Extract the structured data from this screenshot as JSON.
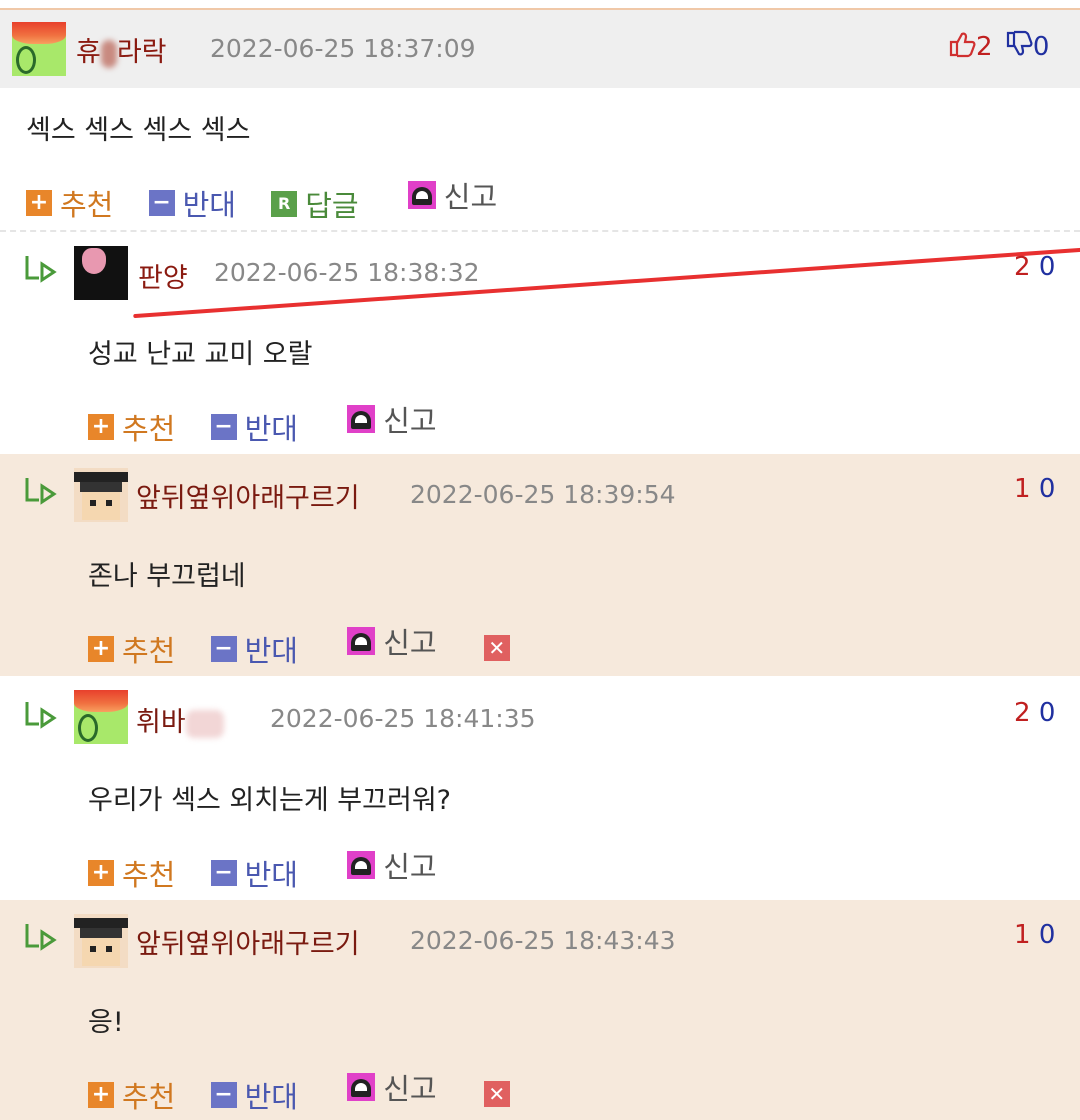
{
  "main": {
    "nickname_left": "휴",
    "nickname_right": "라락",
    "date": "2022-06-25 18:37:09",
    "up_count": "2",
    "down_count": "0",
    "body": "섹스 섹스 섹스 섹스",
    "actions": {
      "recommend": "추천",
      "oppose": "반대",
      "reply": "답글",
      "report": "신고",
      "reply_badge": "R"
    }
  },
  "replies": [
    {
      "nickname": "판양",
      "date": "2022-06-25 18:38:32",
      "up": "2",
      "down": "0",
      "body": "성교 난교 교미 오랄",
      "recommend": "추천",
      "oppose": "반대",
      "report": "신고"
    },
    {
      "nickname": "앞뒤옆위아래구르기",
      "date": "2022-06-25 18:39:54",
      "up": "1",
      "down": "0",
      "body": "존나 부끄럽네",
      "recommend": "추천",
      "oppose": "반대",
      "report": "신고"
    },
    {
      "nickname": "휘바",
      "date": "2022-06-25 18:41:35",
      "up": "2",
      "down": "0",
      "body": "우리가 섹스 외치는게 부끄러워?",
      "recommend": "추천",
      "oppose": "반대",
      "report": "신고"
    },
    {
      "nickname": "앞뒤옆위아래구르기",
      "date": "2022-06-25 18:43:43",
      "up": "1",
      "down": "0",
      "body": "응!",
      "recommend": "추천",
      "oppose": "반대",
      "report": "신고"
    }
  ],
  "icons": {
    "thumb_up": "thumb-up-icon",
    "thumb_down": "thumb-down-icon",
    "reply_arrow": "reply-arrow-icon",
    "report": "siren-icon",
    "delete": "delete-icon"
  },
  "colors": {
    "recommend": "#e8862a",
    "oppose": "#6b74c6",
    "reply": "#5aa04a",
    "delete": "#e06060",
    "tan_bg": "#f6e9dc"
  }
}
